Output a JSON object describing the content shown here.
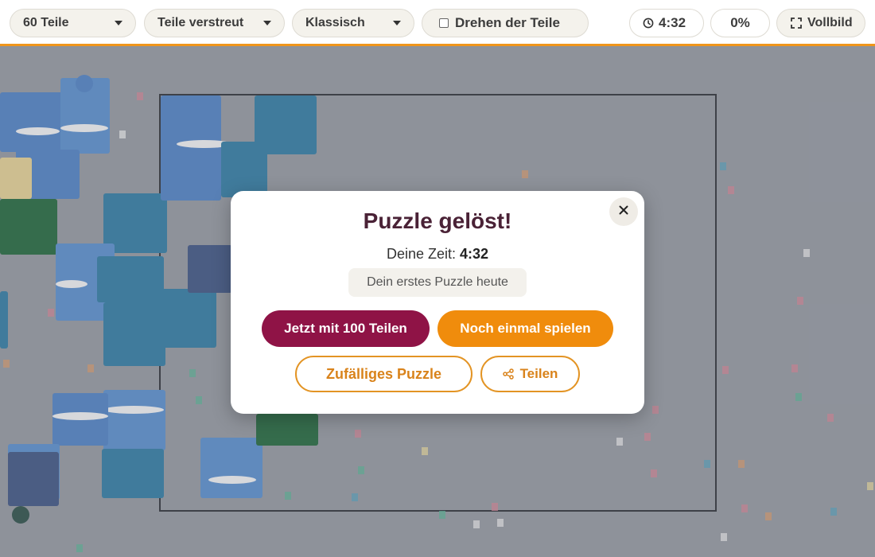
{
  "toolbar": {
    "pieces_select": "60 Teile",
    "layout_select": "Teile verstreut",
    "style_select": "Klassisch",
    "rotate_checkbox_label": "Drehen der Teile",
    "rotate_checked": false,
    "timer": "4:32",
    "progress": "0%",
    "fullscreen_label": "Vollbild"
  },
  "modal": {
    "title": "Puzzle gelöst!",
    "time_label": "Deine Zeit:",
    "time_value": "4:32",
    "note": "Dein erstes Puzzle heute",
    "btn_more_pieces": "Jetzt mit 100 Teilen",
    "btn_play_again": "Noch einmal spielen",
    "btn_random": "Zufälliges Puzzle",
    "btn_share": "Teilen",
    "close_symbol": "×"
  },
  "colors": {
    "accent_orange": "#f08c0c",
    "accent_maroon": "#8f1346",
    "title_color": "#4a2236",
    "toolbar_border": "#f0951a"
  },
  "icons": [
    "chevron-down-icon",
    "clock-icon",
    "fullscreen-icon",
    "close-icon",
    "share-icon"
  ]
}
